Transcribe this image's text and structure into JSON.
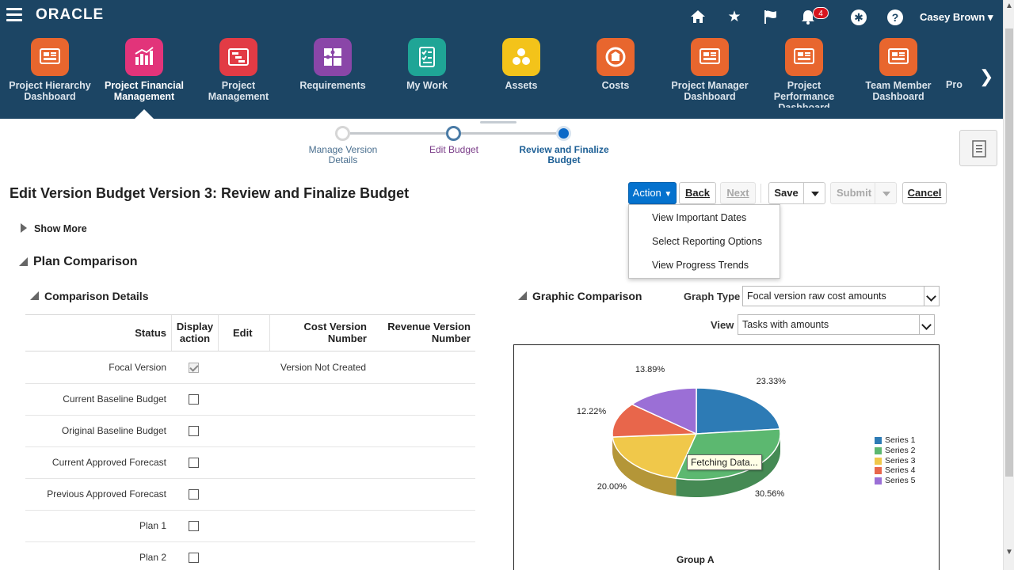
{
  "header": {
    "logo": "ORACLE",
    "user_name": "Casey Brown",
    "notification_count": "4",
    "bg_color": "#1c4564",
    "icons": [
      "home-icon",
      "favorites-star-icon",
      "watchlist-flag-icon",
      "notifications-bell-icon",
      "accessibility-icon",
      "help-icon"
    ]
  },
  "nav": {
    "items": [
      {
        "label": "Project Hierarchy Dashboard",
        "color": "#e8662e",
        "icon": "dashboard-icon"
      },
      {
        "label": "Project Financial Management",
        "color": "#e2347a",
        "icon": "bar-chart-icon",
        "active": true
      },
      {
        "label": "Project Management",
        "color": "#e23b45",
        "icon": "gantt-icon"
      },
      {
        "label": "Requirements",
        "color": "#8a46a8",
        "icon": "puzzle-icon"
      },
      {
        "label": "My Work",
        "color": "#1fa596",
        "icon": "checklist-icon"
      },
      {
        "label": "Assets",
        "color": "#f3c31a",
        "icon": "assets-icon"
      },
      {
        "label": "Costs",
        "color": "#e8662e",
        "icon": "costs-icon"
      },
      {
        "label": "Project Manager Dashboard",
        "color": "#e8662e",
        "icon": "dashboard-icon"
      },
      {
        "label": "Project Performance Dashboard",
        "color": "#e8662e",
        "icon": "dashboard-icon"
      },
      {
        "label": "Team Member Dashboard",
        "color": "#e8662e",
        "icon": "dashboard-icon"
      },
      {
        "label": "Pro",
        "color": "#e8662e",
        "icon": "dashboard-icon"
      }
    ]
  },
  "train": {
    "steps": [
      "Manage Version Details",
      "Edit Budget",
      "Review and Finalize Budget"
    ],
    "current": 2
  },
  "page": {
    "title": "Edit Version Budget Version 3: Review and Finalize Budget"
  },
  "buttons": {
    "action": "Action",
    "back": "Back",
    "next": "Next",
    "save": "Save",
    "submit": "Submit",
    "cancel": "Cancel"
  },
  "action_menu": {
    "items": [
      "View Important Dates",
      "Select Reporting Options",
      "View Progress Trends"
    ]
  },
  "sections": {
    "show_more": "Show More",
    "plan_comparison": "Plan Comparison",
    "comparison_details": "Comparison Details",
    "graphic_comparison": "Graphic Comparison"
  },
  "table": {
    "columns": [
      "Status",
      "Display action",
      "Edit",
      "Cost Version Number",
      "Revenue Version Number"
    ],
    "rows": [
      {
        "status": "Focal Version",
        "checked": true,
        "cost_version": "Version Not Created"
      },
      {
        "status": "Current Baseline Budget",
        "checked": false,
        "cost_version": ""
      },
      {
        "status": "Original Baseline Budget",
        "checked": false,
        "cost_version": ""
      },
      {
        "status": "Current Approved Forecast",
        "checked": false,
        "cost_version": ""
      },
      {
        "status": "Previous Approved Forecast",
        "checked": false,
        "cost_version": ""
      },
      {
        "status": "Plan 1",
        "checked": false,
        "cost_version": ""
      },
      {
        "status": "Plan 2",
        "checked": false,
        "cost_version": ""
      }
    ]
  },
  "graph_controls": {
    "graph_type_label": "Graph Type",
    "graph_type_value": "Focal version raw cost amounts",
    "view_label": "View",
    "view_value": "Tasks with amounts"
  },
  "chart": {
    "tooltip": "Fetching Data...",
    "group_label": "Group A"
  },
  "chart_data": {
    "type": "pie",
    "title": "",
    "categories": [
      "Series 1",
      "Series 2",
      "Series 3",
      "Series 4",
      "Series 5"
    ],
    "values": [
      23.33,
      30.56,
      20.0,
      12.22,
      13.89
    ],
    "labels": [
      "23.33%",
      "30.56%",
      "20.00%",
      "12.22%",
      "13.89%"
    ],
    "colors": [
      "#2d7bb5",
      "#5cb870",
      "#f0c84a",
      "#e8664b",
      "#9b6fd6"
    ],
    "legend": "right",
    "group": "Group A"
  }
}
